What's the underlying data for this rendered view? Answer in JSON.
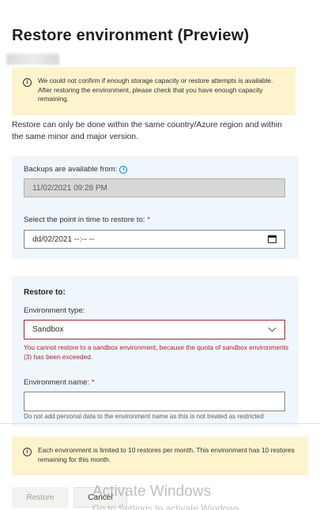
{
  "dialog": {
    "title": "Restore environment (Preview)"
  },
  "warning_capacity": {
    "text": "We could not confirm if enough storage capacity or restore attempts is available. After restoring the environment, please check that you have enough capacity remaining."
  },
  "restore_note": "Restore can only be done within the same country/Azure region and within the same minor and major version.",
  "backups": {
    "label": "Backups are available from:",
    "value": "11/02/2021 09:28 PM"
  },
  "point_in_time": {
    "label": "Select the point in time to restore to:",
    "required_mark": "*",
    "value": "dd/02/2021 --:-- --"
  },
  "restore_to": {
    "heading": "Restore to:",
    "env_type_label": "Environment type:",
    "env_type_value": "Sandbox",
    "env_type_error": "You cannot restore to a sandbox environment, because the quota of sandbox environments (3) has been exceeded.",
    "env_name_label": "Environment name:",
    "env_name_required_mark": "*",
    "env_name_value": "",
    "env_name_help": "Do not add personal data to the environment name as this is not treated as restricted"
  },
  "warning_restores": {
    "text": "Each environment is limited to 10 restores per month. This environment has 10 restores remaining for this month."
  },
  "footer": {
    "restore_label": "Restore",
    "cancel_label": "Cancel"
  },
  "watermark": {
    "line1": "Activate Windows",
    "line2": "Go to Settings to activate Windows."
  },
  "colors": {
    "warning_bg": "#fdf4ce",
    "panel_bg": "#eff6fc",
    "error": "#a4262c",
    "accent": "#0078d4"
  }
}
